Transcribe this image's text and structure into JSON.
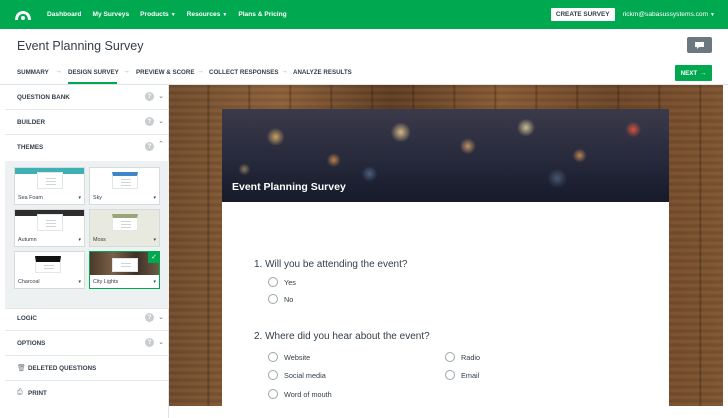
{
  "nav": {
    "items": [
      {
        "label": "Dashboard",
        "caret": false
      },
      {
        "label": "My Surveys",
        "caret": false
      },
      {
        "label": "Products",
        "caret": true
      },
      {
        "label": "Resources",
        "caret": true
      },
      {
        "label": "Plans & Pricing",
        "caret": false
      }
    ],
    "create_button": "CREATE SURVEY",
    "user_email": "rickm@sabasussystems.com",
    "brand_color": "#00a84f"
  },
  "survey_title": "Event Planning Survey",
  "steps": {
    "items": [
      "SUMMARY",
      "DESIGN SURVEY",
      "PREVIEW & SCORE",
      "COLLECT RESPONSES",
      "ANALYZE RESULTS"
    ],
    "active": "DESIGN SURVEY",
    "next_label": "NEXT"
  },
  "sidebar": {
    "question_bank": "QUESTION BANK",
    "builder": "BUILDER",
    "themes": "THEMES",
    "logic": "LOGIC",
    "options": "OPTIONS",
    "deleted_questions": "DELETED QUESTIONS",
    "print": "PRINT",
    "theme_list": [
      {
        "name": "Sea Foam",
        "color": "#3fb0b3",
        "selected": false
      },
      {
        "name": "Sky",
        "color": "#3d86c9",
        "selected": false
      },
      {
        "name": "Autumn",
        "color": "#2e2e2e",
        "selected": false
      },
      {
        "name": "Moss",
        "color": "#9aa37a",
        "selected": false
      },
      {
        "name": "Charcoal",
        "color": "#111111",
        "selected": false
      },
      {
        "name": "City Lights",
        "color": "#6d5a46",
        "selected": true
      }
    ]
  },
  "preview": {
    "header_title": "Event Planning Survey",
    "questions": [
      {
        "text": "1. Will you be attending the event?",
        "choices": [
          "Yes",
          "No"
        ]
      },
      {
        "text": "2. Where did you hear about the event?",
        "choices": [
          "Website",
          "Radio",
          "Social media",
          "Email",
          "Word of mouth"
        ]
      }
    ]
  }
}
